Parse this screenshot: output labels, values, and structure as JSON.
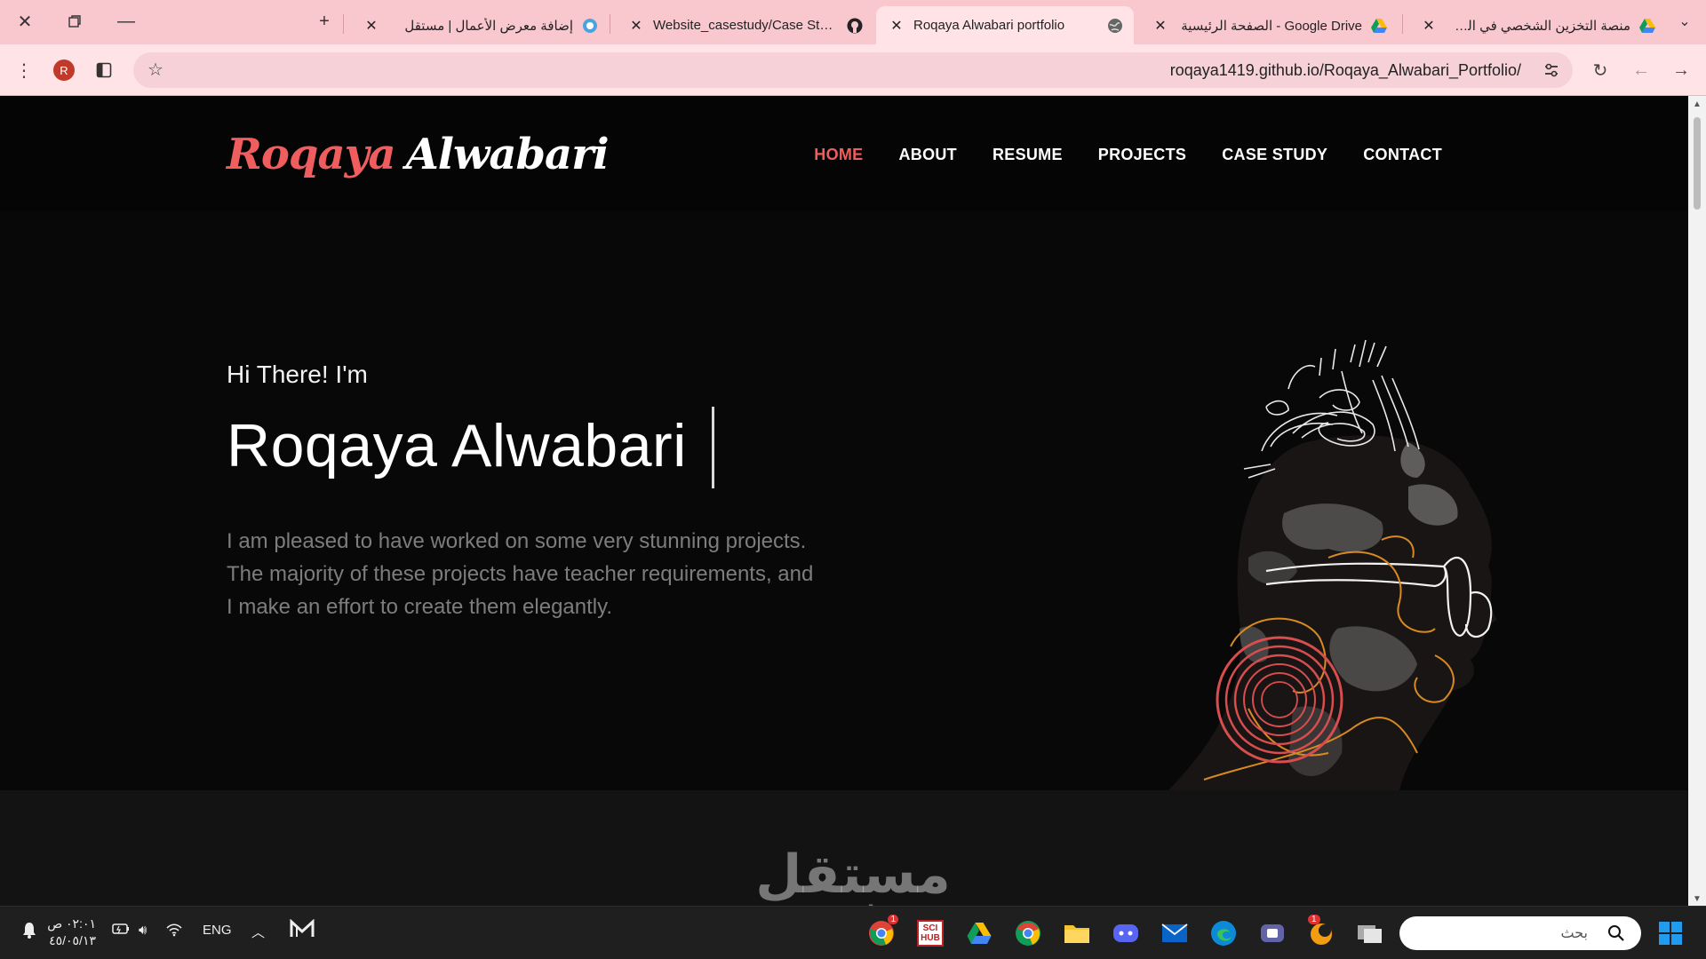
{
  "browser": {
    "tabs": [
      {
        "title": "إضافة معرض الأعمال | مستقل",
        "active": false
      },
      {
        "title": "Website_casestudy/Case Study.",
        "active": false
      },
      {
        "title": "Roqaya Alwabari portfolio",
        "active": true
      },
      {
        "title": "Google Drive - الصفحة الرئيسية",
        "active": false
      },
      {
        "title": "منصة التخزين الشخصي في السحا",
        "active": false
      }
    ],
    "new_tab_label": "+",
    "profile_initial": "R",
    "url": "roqaya1419.github.io/Roqaya_Alwabari_Portfolio/"
  },
  "site": {
    "logo": {
      "first": "Roqaya",
      "last": "Alwabari"
    },
    "nav": [
      {
        "label": "HOME",
        "active": true
      },
      {
        "label": "ABOUT",
        "active": false
      },
      {
        "label": "RESUME",
        "active": false
      },
      {
        "label": "PROJECTS",
        "active": false
      },
      {
        "label": "CASE STUDY",
        "active": false
      },
      {
        "label": "CONTACT",
        "active": false
      }
    ],
    "hero": {
      "greeting": "Hi There! I'm",
      "name": "Roqaya Alwabari",
      "intro_lines": [
        "I am pleased to have worked on some very stunning projects.",
        "The majority of these projects have teacher requirements, and",
        "I make an effort to create them elegantly."
      ]
    },
    "accent_color": "#f05d5e"
  },
  "watermark": {
    "arabic": "مستقل",
    "latin": "mostaql.com"
  },
  "taskbar": {
    "clock_time": "٠٢:٠١ ص",
    "clock_date": "٤٥/٠٥/١٣",
    "language": "ENG",
    "search_placeholder": "بحث",
    "chrome_badge": "1",
    "app_badge": "1",
    "scihub_label": "SCI HUB"
  }
}
